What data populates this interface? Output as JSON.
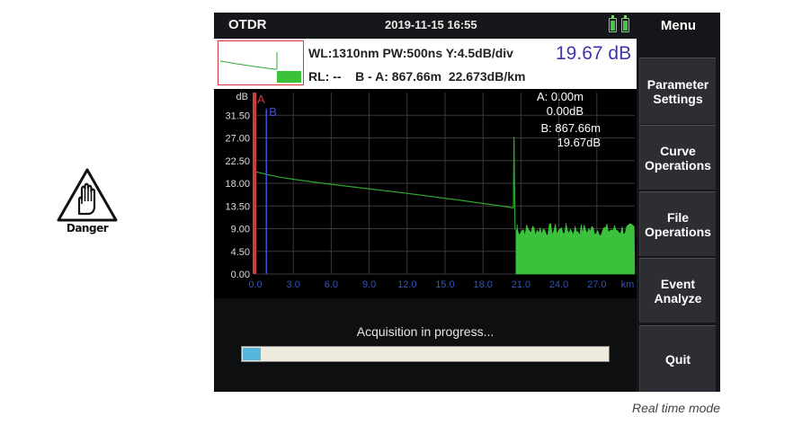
{
  "warning": {
    "label": "Danger",
    "icon": "hand-stop-icon"
  },
  "header": {
    "title": "OTDR",
    "datetime": "2019-11-15 16:55",
    "battery_icon": "battery-icon"
  },
  "info": {
    "wl_line": "WL:1310nm PW:500ns Y:4.5dB/div",
    "loss_value": "19.67 dB",
    "rl_line": "RL: --    B - A: 867.66m  22.673dB/km"
  },
  "menu": {
    "title": "Menu",
    "items": [
      {
        "label": "Parameter\nSettings"
      },
      {
        "label": "Curve\nOperations"
      },
      {
        "label": "File\nOperations"
      },
      {
        "label": "Event\nAnalyze"
      },
      {
        "label": "Quit"
      }
    ]
  },
  "cursors": {
    "a_label": "A",
    "b_label": "B",
    "a_distance": "A: 0.00m",
    "a_db": "0.00dB",
    "b_distance": "B: 867.66m",
    "b_db": "19.67dB",
    "a_position_km": 0.0,
    "b_position_km": 0.87
  },
  "chart_data": {
    "type": "line",
    "y_unit_label": "dB",
    "x_unit_label": "km",
    "x_ticks": [
      "0.0",
      "3.0",
      "6.0",
      "9.0",
      "12.0",
      "15.0",
      "18.0",
      "21.0",
      "24.0",
      "27.0"
    ],
    "y_ticks": [
      "31.50",
      "27.00",
      "22.50",
      "18.00",
      "13.50",
      "9.00",
      "4.50",
      "0.00"
    ],
    "xlim": [
      0,
      30
    ],
    "ylim": [
      0,
      36
    ],
    "trace": {
      "points": [
        [
          0.0,
          20.3
        ],
        [
          1.0,
          19.7
        ],
        [
          2.0,
          19.2
        ],
        [
          3.0,
          18.8
        ],
        [
          5.0,
          18.1
        ],
        [
          8.0,
          17.2
        ],
        [
          12.0,
          16.0
        ],
        [
          16.0,
          14.7
        ],
        [
          20.0,
          13.3
        ],
        [
          20.4,
          13.1
        ]
      ],
      "reflection_peak": {
        "x": 20.45,
        "y": 27.2
      },
      "noise_floor": {
        "x_start": 20.6,
        "x_end": 30.0,
        "mean": 8.8,
        "spread": 1.3,
        "spike_x": 20.7,
        "spike_y": 9.8
      }
    },
    "colors": {
      "trace": "#2fa52f",
      "noise": "#3bc13b",
      "cursor_a": "#d33a3a",
      "cursor_b": "#3f4fd8",
      "grid": "#3a3a3a",
      "ticks": "#dcdcdc",
      "x_ticks": "#2f56b8"
    }
  },
  "status": {
    "message": "Acquisition in progress...",
    "progress": 0.05
  },
  "caption": "Real time mode"
}
